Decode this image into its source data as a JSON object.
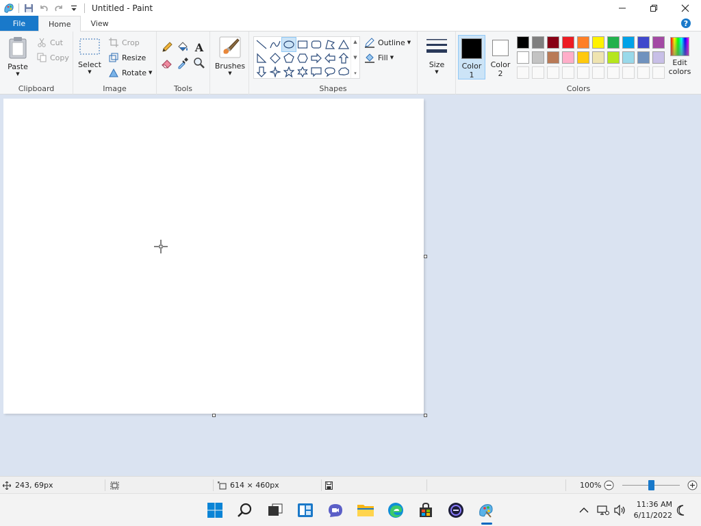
{
  "window": {
    "title": "Untitled - Paint"
  },
  "tabs": [
    {
      "label": "File"
    },
    {
      "label": "Home"
    },
    {
      "label": "View"
    }
  ],
  "ribbon": {
    "clipboard": {
      "label": "Clipboard",
      "paste": "Paste",
      "cut": "Cut",
      "copy": "Copy"
    },
    "image": {
      "label": "Image",
      "select": "Select",
      "crop": "Crop",
      "resize": "Resize",
      "rotate": "Rotate"
    },
    "tools": {
      "label": "Tools"
    },
    "brushes": {
      "label": "Brushes"
    },
    "shapes": {
      "label": "Shapes",
      "outline": "Outline",
      "fill": "Fill",
      "selected": "oval"
    },
    "size": {
      "label": "Size"
    },
    "colors": {
      "label": "Colors",
      "color1_line1": "Color",
      "color1_line2": "1",
      "color2_line1": "Color",
      "color2_line2": "2",
      "edit_line1": "Edit",
      "edit_line2": "colors",
      "color1_value": "#000000",
      "color2_value": "#ffffff",
      "palette": [
        "#000000",
        "#7f7f7f",
        "#880015",
        "#ed1c24",
        "#ff7f27",
        "#fff200",
        "#22b14c",
        "#00a2e8",
        "#3f48cc",
        "#a349a4",
        "#ffffff",
        "#c3c3c3",
        "#b97a57",
        "#ffaec9",
        "#ffc90e",
        "#efe4b0",
        "#b5e61d",
        "#99d9ea",
        "#7092be",
        "#c8bfe7"
      ],
      "empty_slots": 10
    }
  },
  "canvas": {
    "background": "#ffffff"
  },
  "status": {
    "cursor_pos": "243, 69px",
    "selection_size": "",
    "canvas_size": "614 × 460px",
    "zoom": "100%",
    "zoom_fraction": 0.5
  },
  "taskbar": {
    "time": "11:36 AM",
    "date": "6/11/2022",
    "apps": [
      "start-icon",
      "search-icon",
      "task-view-icon",
      "widgets-icon",
      "chat-icon",
      "file-explorer-icon",
      "edge-icon",
      "store-icon",
      "app-icon",
      "paint-icon"
    ]
  }
}
